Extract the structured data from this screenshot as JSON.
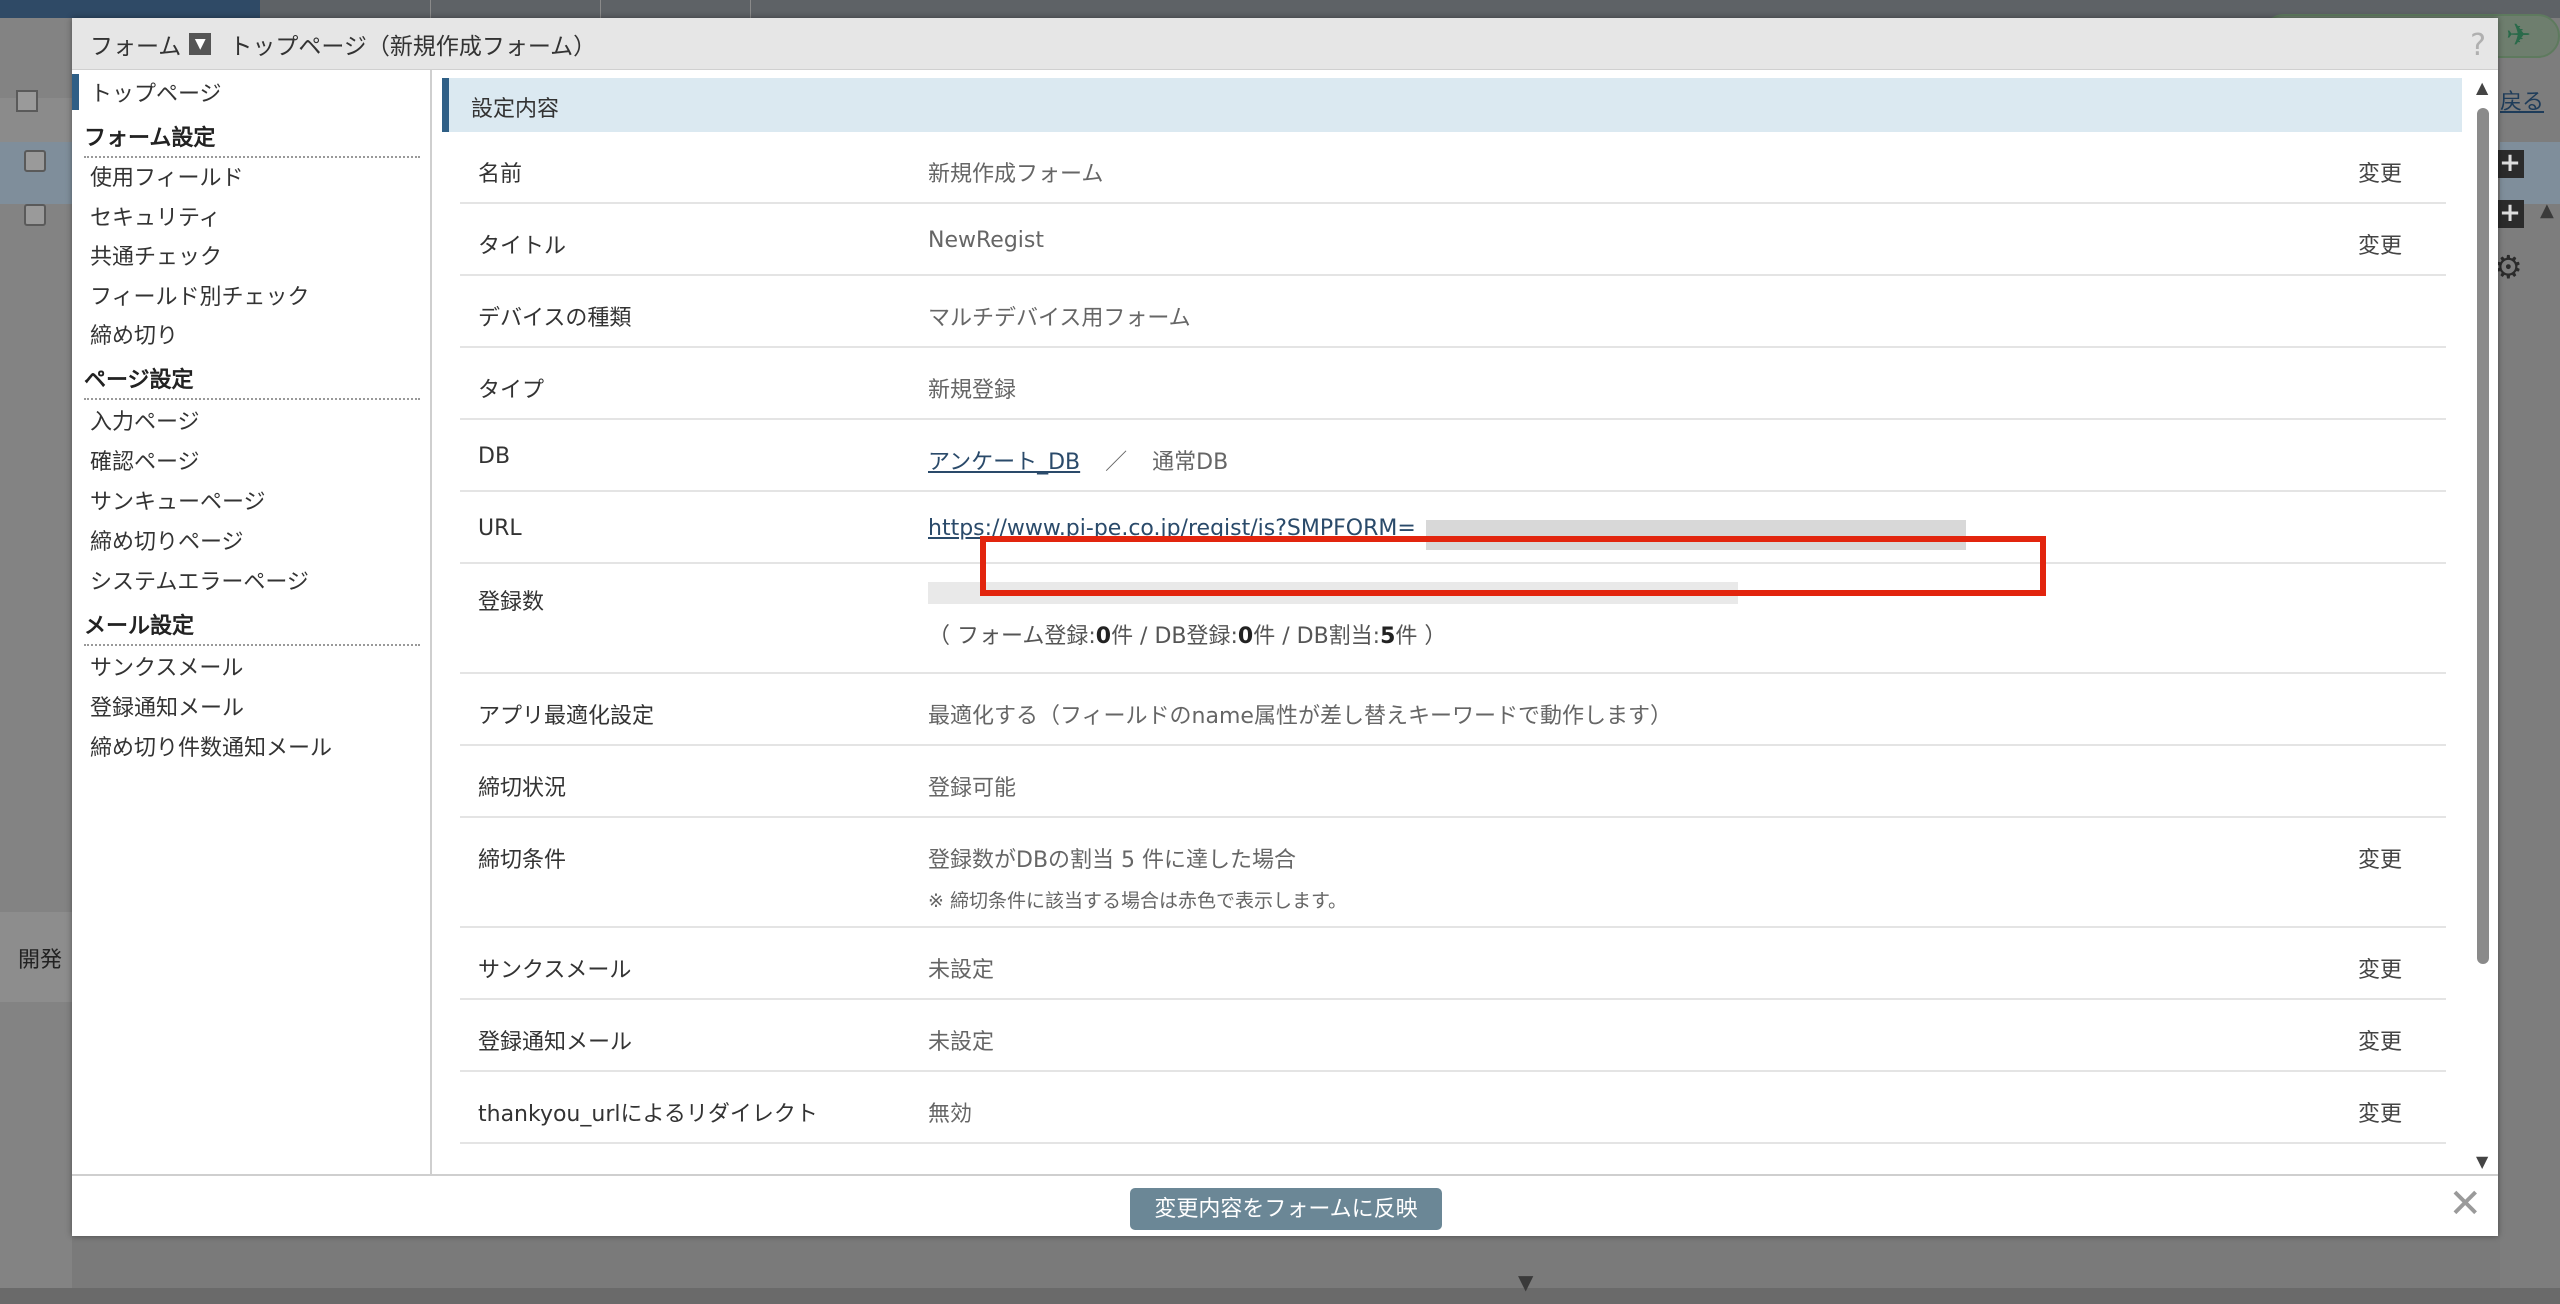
{
  "background": {
    "dev_label": "開発",
    "back_link": "戻る"
  },
  "modal": {
    "breadcrumb_root": "フォーム",
    "breadcrumb_page": "トップページ（新規作成フォーム）",
    "help": "?",
    "close": "✕",
    "apply_button": "変更内容をフォームに反映"
  },
  "sidebar": {
    "top_page": "トップページ",
    "sections": [
      {
        "title": "フォーム設定",
        "items": [
          "使用フィールド",
          "セキュリティ",
          "共通チェック",
          "フィールド別チェック",
          "締め切り"
        ]
      },
      {
        "title": "ページ設定",
        "items": [
          "入力ページ",
          "確認ページ",
          "サンキューページ",
          "締め切りページ",
          "システムエラーページ"
        ]
      },
      {
        "title": "メール設定",
        "items": [
          "サンクスメール",
          "登録通知メール",
          "締め切り件数通知メール"
        ]
      }
    ]
  },
  "main": {
    "section_title": "設定内容",
    "change_label": "変更",
    "rows": {
      "name": {
        "label": "名前",
        "value": "新規作成フォーム"
      },
      "title": {
        "label": "タイトル",
        "value": "NewRegist"
      },
      "device": {
        "label": "デバイスの種類",
        "value": "マルチデバイス用フォーム"
      },
      "type": {
        "label": "タイプ",
        "value": "新規登録"
      },
      "db": {
        "label": "DB",
        "link": "アンケート_DB",
        "separator": "／",
        "kind": "通常DB"
      },
      "url": {
        "label": "URL",
        "value": "https://www.pi-pe.co.jp/regist/is?SMPFORM="
      },
      "count": {
        "label": "登録数",
        "open": "（ フォーム登録:",
        "form_count": "0",
        "unit1": "件 / DB登録:",
        "db_count": "0",
        "unit2": "件 / DB割当:",
        "quota": "5",
        "close": "件 ）",
        "fill_fraction": 0
      },
      "app_opt": {
        "label": "アプリ最適化設定",
        "value": "最適化する（フィールドのname属性が差し替えキーワードで動作します）"
      },
      "status": {
        "label": "締切状況",
        "value": "登録可能"
      },
      "condition": {
        "label": "締切条件",
        "value": "登録数がDBの割当 5 件に達した場合",
        "note": "※ 締切条件に該当する場合は赤色で表示します。"
      },
      "thanks_mail": {
        "label": "サンクスメール",
        "value": "未設定"
      },
      "notify_mail": {
        "label": "登録通知メール",
        "value": "未設定"
      },
      "redirect": {
        "label": "thankyou_urlによるリダイレクト",
        "value": "無効"
      }
    }
  },
  "colors": {
    "accent": "#2f5f86",
    "section_bg": "#dbe9f1",
    "highlight_border": "#e2250e",
    "button_bg": "#6b8796"
  }
}
